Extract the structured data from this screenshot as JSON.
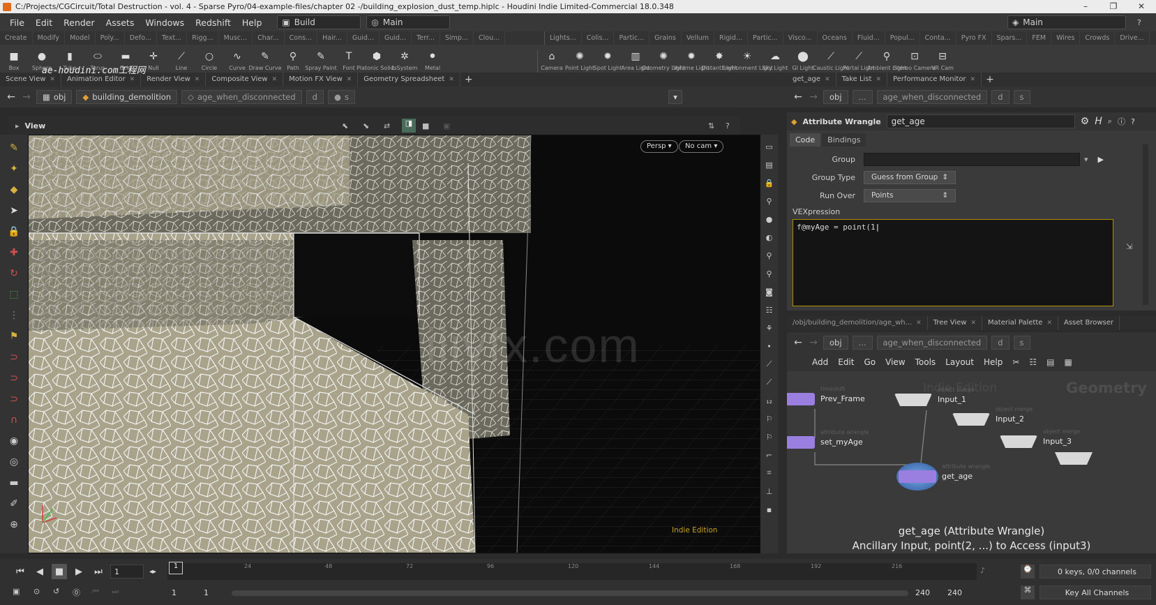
{
  "window": {
    "title": "C:/Projects/CGCircuit/Total Destruction - vol. 4 - Sparse Pyro/04-example-files/chapter 02 -/building_explosion_dust_temp.hiplc - Houdini Indie Limited-Commercial 18.0.348",
    "minimize": "–",
    "restore": "❐",
    "close": "✕"
  },
  "menubar": {
    "items": [
      "File",
      "Edit",
      "Render",
      "Assets",
      "Windows",
      "Redshift",
      "Help"
    ],
    "desktop_build": "Build",
    "desktop_main": "Main",
    "desktop_right": "Main"
  },
  "shelf_tabs_left": [
    "Create",
    "Modify",
    "Model",
    "Poly...",
    "Defo...",
    "Text...",
    "Rigg...",
    "Musc...",
    "Char...",
    "Cons...",
    "Hair...",
    "Guid...",
    "Guid...",
    "Terr...",
    "Simp...",
    "Clou..."
  ],
  "shelf_tabs_right": [
    "Lights...",
    "Colis...",
    "Partic...",
    "Grains",
    "Vellum",
    "Rigid...",
    "Partic...",
    "Visco...",
    "Oceans",
    "Fluid...",
    "Popul...",
    "Conta...",
    "Pyro FX",
    "Spars...",
    "FEM",
    "Wires",
    "Crowds",
    "Drive..."
  ],
  "shelf_tools_left": [
    "Box",
    "Sphere",
    "Tube",
    "Torus",
    "Grid",
    "Null",
    "Line",
    "Circle",
    "Curve",
    "Draw Curve",
    "Path",
    "Spray Paint",
    "Font",
    "Platonic Solids",
    "L-System",
    "Metal"
  ],
  "shelf_tools_right": [
    "Camera",
    "Point Light",
    "Spot Light",
    "Area Light",
    "Geometry Light",
    "Volume Light",
    "Distant Light",
    "Environment Light",
    "Sky Light",
    "GI Light",
    "Caustic Light",
    "Portal Light",
    "Ambient Light",
    "Stereo Camera",
    "VR Cam"
  ],
  "left_pane": {
    "tabs": [
      "Scene View",
      "Animation Editor",
      "Render View",
      "Composite View",
      "Motion FX View",
      "Geometry Spreadsheet"
    ],
    "path": [
      "obj",
      "building_demolition",
      "age_when_disconnected",
      "d",
      "s"
    ],
    "view_label": "View",
    "persp": "Persp ▾",
    "cam": "No cam ▾",
    "edition": "Indie Edition",
    "brand": "ae-houdini.com工程网"
  },
  "param_pane": {
    "tabs": [
      "get_age",
      "Take List",
      "Performance Monitor"
    ],
    "path": [
      "obj",
      "...",
      "age_when_disconnected",
      "d",
      "s"
    ],
    "node_type": "Attribute Wrangle",
    "node_name": "get_age",
    "subtabs": [
      "Code",
      "Bindings"
    ],
    "group_label": "Group",
    "group_value": "",
    "group_type_label": "Group Type",
    "group_type_value": "Guess from Group",
    "run_over_label": "Run Over",
    "run_over_value": "Points",
    "vex_label": "VEXpression",
    "vex_code": "f@myAge = point(1"
  },
  "network_pane": {
    "tabs": [
      "/obj/building_demolition/age_wh...",
      "Tree View",
      "Material Palette",
      "Asset Browser"
    ],
    "path": [
      "obj",
      "...",
      "age_when_disconnected",
      "d",
      "s"
    ],
    "menu": [
      "Add",
      "Edit",
      "Go",
      "View",
      "Tools",
      "Layout",
      "Help"
    ],
    "watermark_edition": "Indie Edition",
    "watermark_context": "Geometry",
    "nodes": [
      {
        "name": "Prev_Frame",
        "type": "timeshift",
        "color": "#9b7fe0"
      },
      {
        "name": "set_myAge",
        "type": "attribute wrangle",
        "color": "#9b7fe0"
      },
      {
        "name": "get_age",
        "type": "attribute wrangle",
        "color": "#4a7fc0"
      },
      {
        "name": "Input_1",
        "type": "object merge",
        "color": "#d8d8d8"
      },
      {
        "name": "Input_2",
        "type": "object merge",
        "color": "#d8d8d8"
      },
      {
        "name": "Input_3",
        "type": "object merge",
        "color": "#d8d8d8"
      }
    ],
    "caption_title": "get_age (Attribute Wrangle)",
    "caption_sub": "Ancillary Input, point(2, ...) to Access (input3)"
  },
  "timeline": {
    "current_frame": "1",
    "start_marker": "1",
    "ticks": [
      "24",
      "48",
      "72",
      "96",
      "120",
      "144",
      "168",
      "192",
      "216"
    ],
    "range_start": "1",
    "range_start2": "1",
    "range_end": "240",
    "range_end2": "240",
    "keys": "0 keys, 0/0 channels",
    "key_all": "Key All Channels"
  },
  "watermark": "iiivfx.com"
}
